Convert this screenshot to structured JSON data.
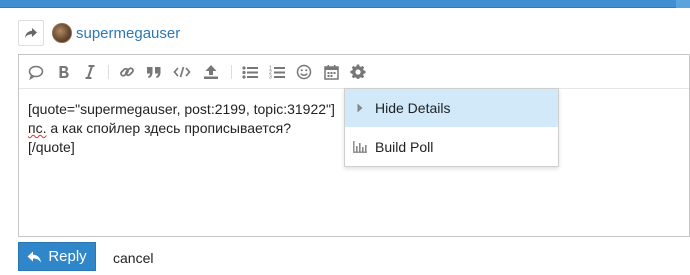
{
  "composer": {
    "username": "supermegauser",
    "toolbar": {
      "buttons": [
        {
          "name": "quote-icon"
        },
        {
          "name": "bold-icon"
        },
        {
          "name": "italic-icon"
        },
        {
          "name": "link-icon"
        },
        {
          "name": "blockquote-icon"
        },
        {
          "name": "code-icon"
        },
        {
          "name": "upload-icon"
        },
        {
          "name": "bullet-list-icon"
        },
        {
          "name": "numbered-list-icon"
        },
        {
          "name": "emoji-icon"
        },
        {
          "name": "calendar-icon"
        },
        {
          "name": "gear-icon"
        }
      ]
    },
    "text": {
      "line1": "[quote=\"supermegauser, post:2199, topic:31922\"]",
      "line2_word": "пс.",
      "line2_rest": " а как спойлер здесь прописывается?",
      "line3": "[/quote]"
    },
    "options_menu": {
      "items": [
        {
          "label": "Hide Details",
          "icon": "caret-right-icon",
          "active": true
        },
        {
          "label": "Build Poll",
          "icon": "bar-chart-icon",
          "active": false
        }
      ]
    },
    "actions": {
      "reply_label": "Reply",
      "cancel_label": "cancel"
    }
  },
  "colors": {
    "accent": "#2f86c9",
    "link": "#2a78b7",
    "menu_highlight": "#d1e9f9"
  }
}
